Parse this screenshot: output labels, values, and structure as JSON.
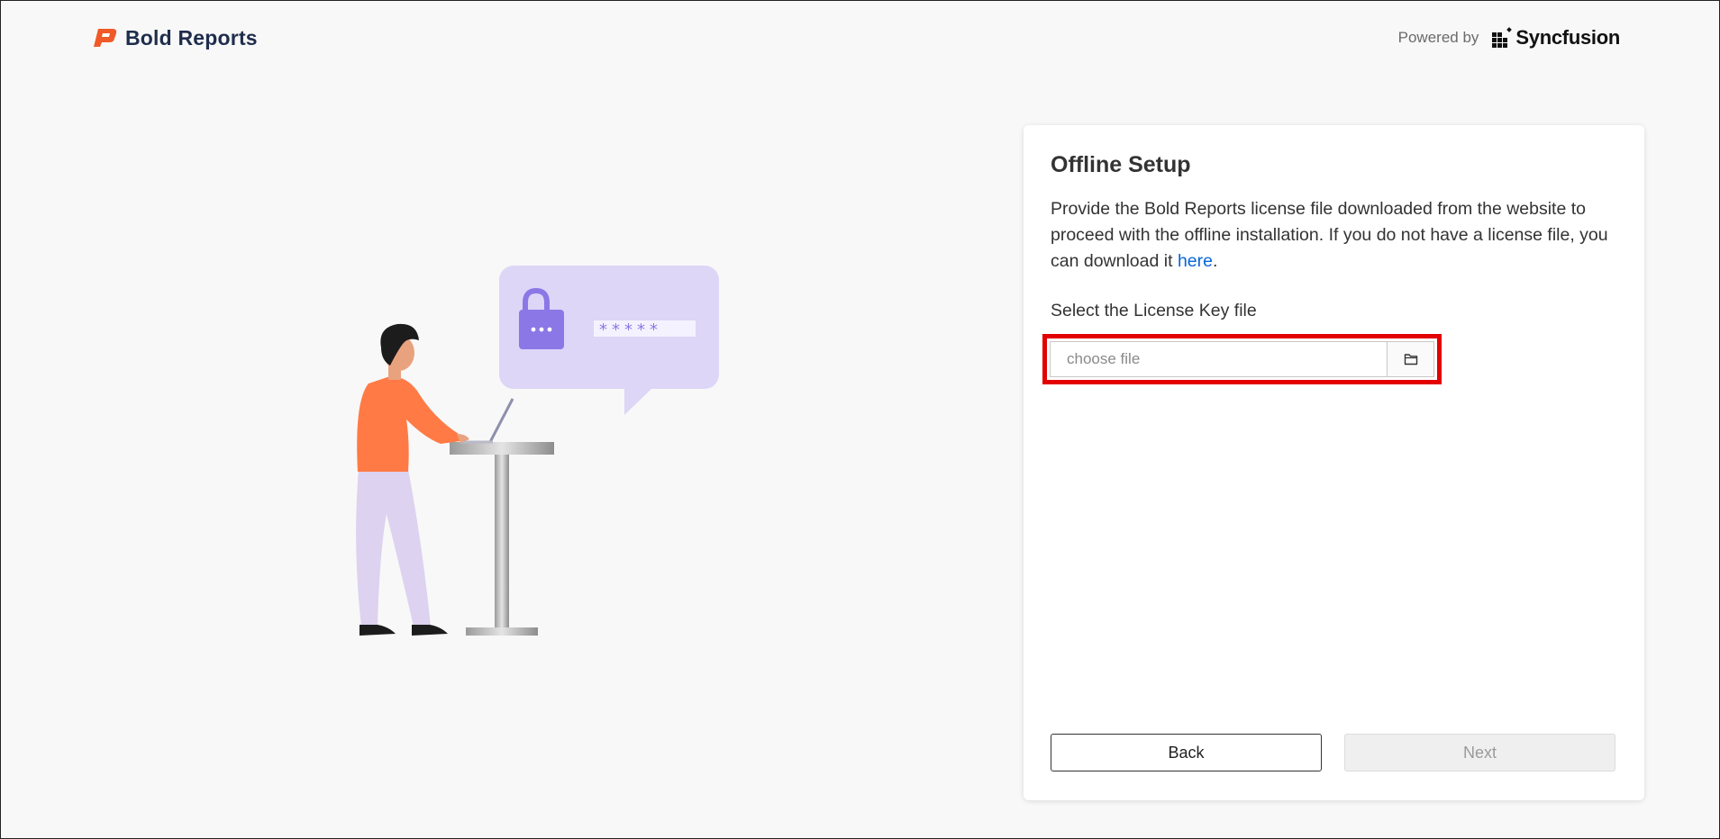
{
  "header": {
    "brand_name": "Bold Reports",
    "powered_by_label": "Powered by",
    "partner_name": "Syncfusion"
  },
  "illustration": {
    "password_mask": "*****"
  },
  "setup": {
    "title": "Offline Setup",
    "description_before_link": "Provide the Bold Reports license file downloaded from the website to proceed with the offline installation. If you do not have a license file, you can download it ",
    "link_text": "here",
    "description_after_link": ".",
    "field_label": "Select the License Key file",
    "file_input_placeholder": "choose file",
    "file_input_value": "",
    "browse_icon": "folder-icon",
    "back_label": "Back",
    "next_label": "Next"
  },
  "colors": {
    "brand_accent": "#f05a28",
    "brand_text": "#1f2d4d",
    "link": "#0a66d6",
    "highlight_border": "#e30000",
    "illustration_bubble": "#ddd6f7",
    "illustration_lock": "#8b78e6",
    "person_shirt": "#ff7a45"
  }
}
